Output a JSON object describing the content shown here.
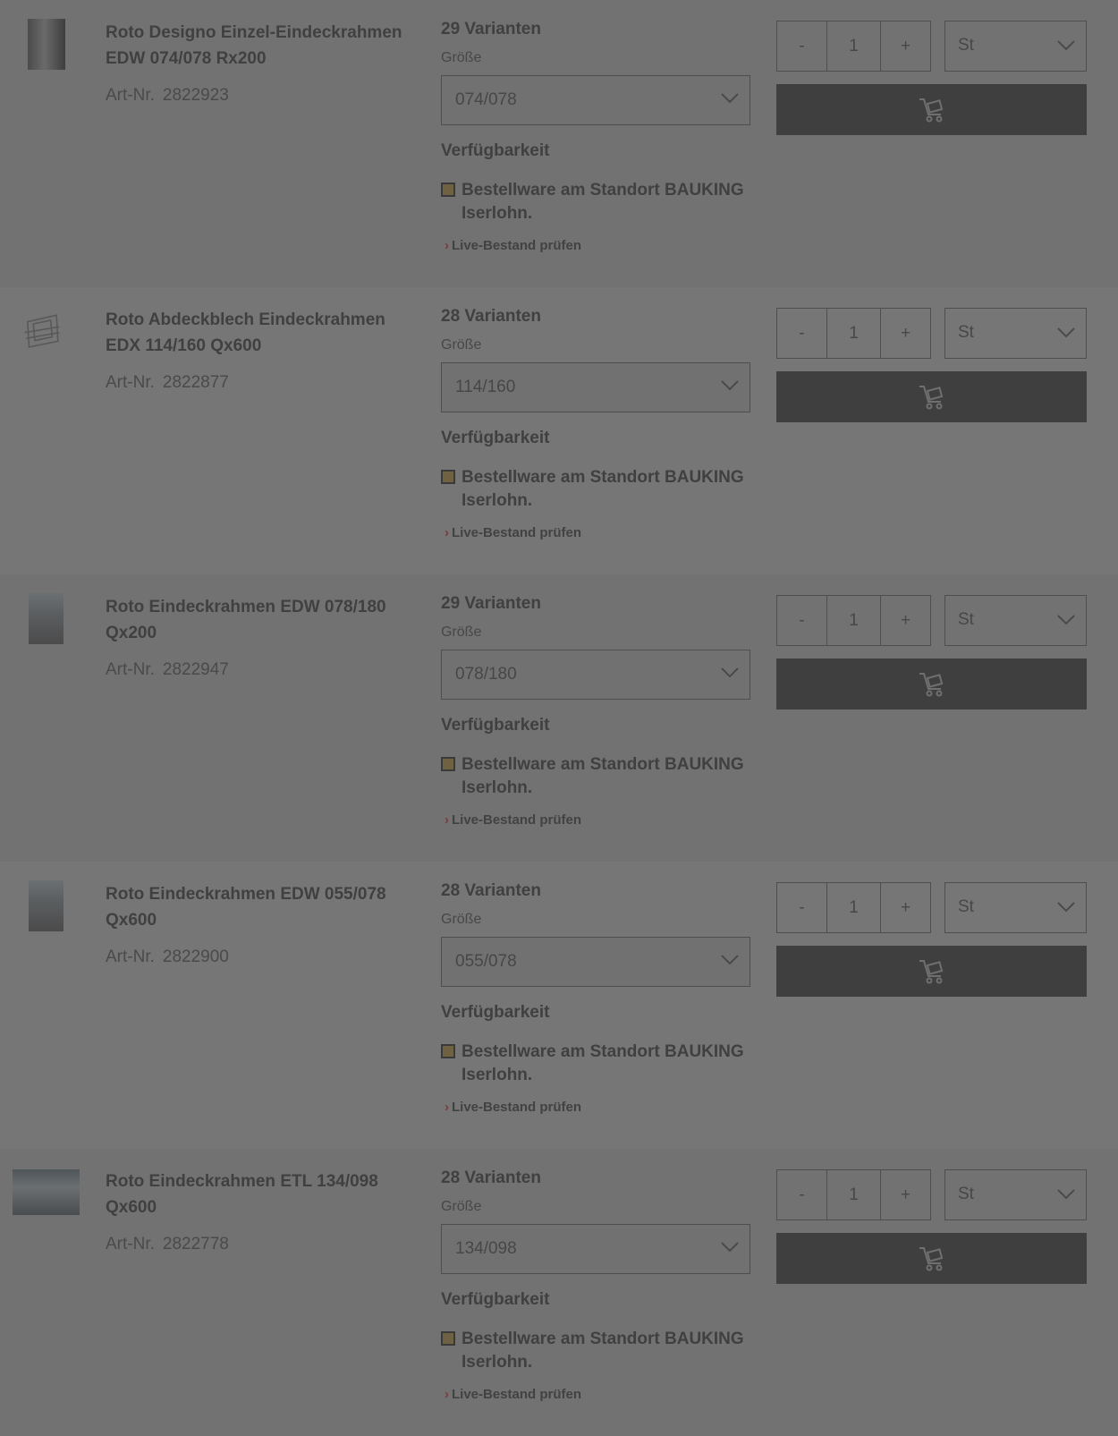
{
  "labels": {
    "size": "Größe",
    "availability": "Verfügbarkeit",
    "art_prefix": "Art-Nr.",
    "live_check": "Live-Bestand prüfen",
    "qty_minus": "-",
    "qty_plus": "+"
  },
  "products": [
    {
      "title": "Roto Designo Einzel-Eindeckrahmen EDW 074/078 Rx200",
      "art_nr": "2822923",
      "variants": "29 Varianten",
      "size": "074/078",
      "stock": "Bestellware am Standort BAUKING Iserlohn.",
      "qty": "1",
      "unit": "St"
    },
    {
      "title": "Roto Abdeckblech Eindeckrahmen EDX 114/160 Qx600",
      "art_nr": "2822877",
      "variants": "28 Varianten",
      "size": "114/160",
      "stock": "Bestellware am Standort BAUKING Iserlohn.",
      "qty": "1",
      "unit": "St"
    },
    {
      "title": "Roto Eindeckrahmen EDW 078/180 Qx200",
      "art_nr": "2822947",
      "variants": "29 Varianten",
      "size": "078/180",
      "stock": "Bestellware am Standort BAUKING Iserlohn.",
      "qty": "1",
      "unit": "St"
    },
    {
      "title": "Roto Eindeckrahmen EDW 055/078 Qx600",
      "art_nr": "2822900",
      "variants": "28 Varianten",
      "size": "055/078",
      "stock": "Bestellware am Standort BAUKING Iserlohn.",
      "qty": "1",
      "unit": "St"
    },
    {
      "title": "Roto Eindeckrahmen ETL 134/098 Qx600",
      "art_nr": "2822778",
      "variants": "28 Varianten",
      "size": "134/098",
      "stock": "Bestellware am Standort BAUKING Iserlohn.",
      "qty": "1",
      "unit": "St"
    }
  ],
  "icons": {
    "chevron": "chevron-down-icon",
    "cart": "shopping-cart-icon",
    "arrow": "chevron-right-icon"
  },
  "colors": {
    "stock_indicator": "#6e6242",
    "cart_button": "#3f3f3f"
  }
}
